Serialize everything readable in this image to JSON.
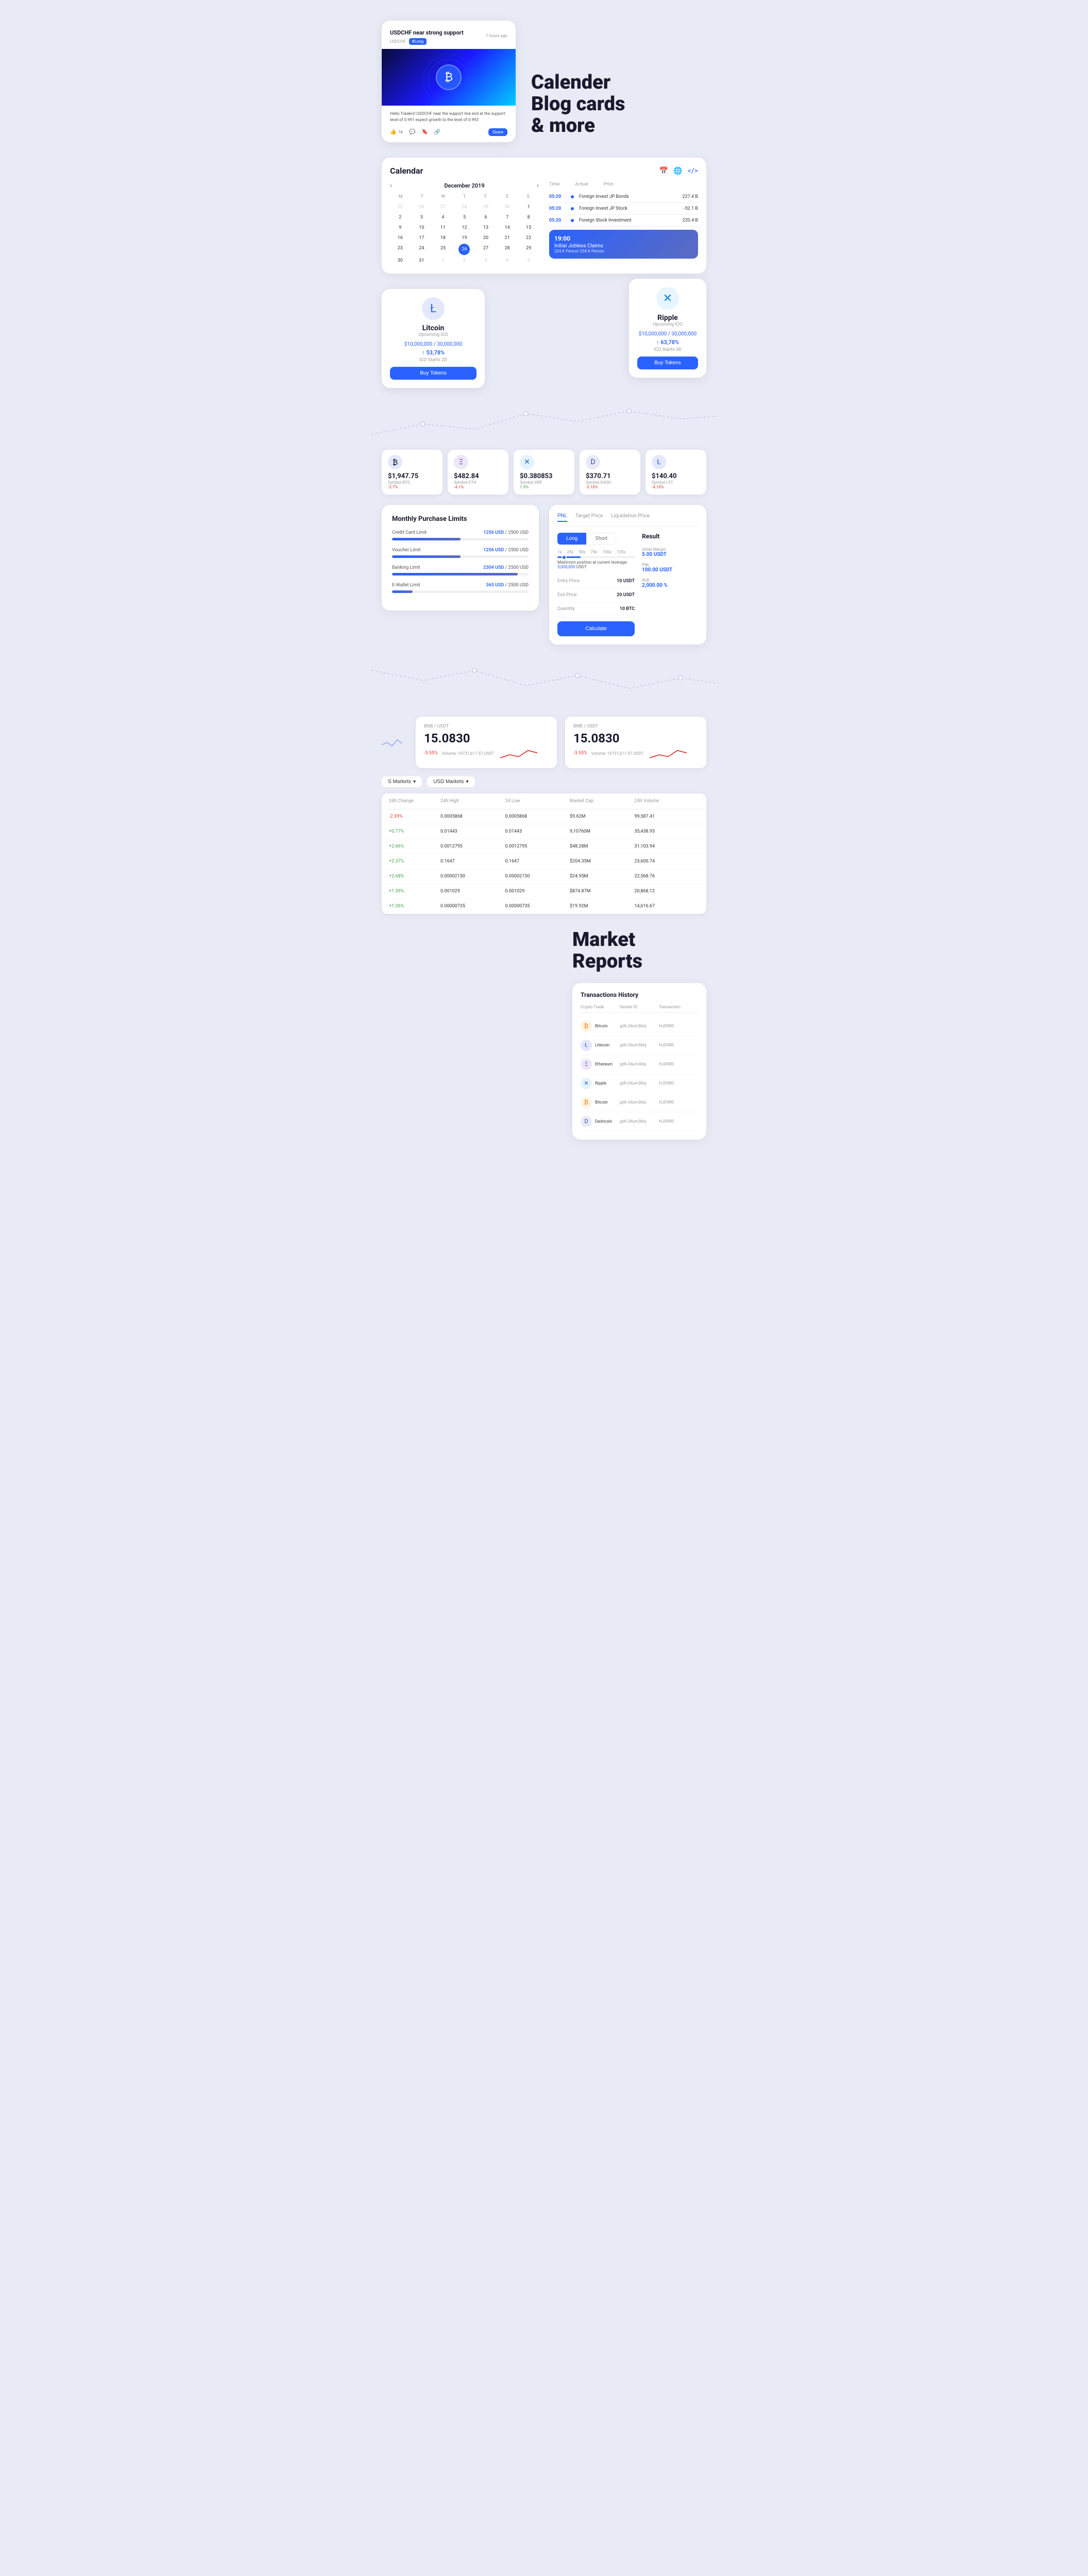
{
  "blogCard": {
    "title": "USDCHF near strong support",
    "ticker": "USDCHF",
    "badge": "#Long",
    "timeAgo": "7 hours ago",
    "description": "Hello Traders! USDCHF near the support line end at the support level of 0.991 expect growth to the level of 0.993",
    "likeCount": "1k",
    "commentCount": "",
    "shareLabel": "Share"
  },
  "sectionHeading": "Calender\nBlog cards\n& more",
  "calendar": {
    "label": "Calendar",
    "month": "December 2019",
    "days": [
      "M",
      "T",
      "W",
      "T",
      "F",
      "S",
      "S"
    ],
    "cells": [
      "25",
      "26",
      "27",
      "28",
      "29",
      "30",
      "1",
      "2",
      "3",
      "4",
      "5",
      "6",
      "7",
      "8",
      "9",
      "10",
      "11",
      "12",
      "13",
      "14",
      "15",
      "16",
      "17",
      "18",
      "19",
      "20",
      "21",
      "22",
      "23",
      "24",
      "25",
      "26",
      "27",
      "28",
      "29",
      "30",
      "31",
      "1",
      "2",
      "3",
      "4",
      "5"
    ],
    "today": "26",
    "events": {
      "headers": [
        "Time",
        "Actual",
        "Prior"
      ],
      "rows": [
        {
          "time": "05:20",
          "name": "Foreign Invest JP Bonds",
          "value": "227.4 B"
        },
        {
          "time": "05:20",
          "name": "Foreign Invest JP Stock",
          "value": "-52.1 B"
        },
        {
          "time": "05:20",
          "name": "Foreign Stock Investment",
          "value": "220.4 B"
        }
      ],
      "featured": {
        "time": "19:00",
        "title": "Initial Jobless Claims",
        "desc": "224 K Person 234 K Person"
      }
    }
  },
  "icoCards": {
    "litecoin": {
      "name": "Litcoin",
      "type": "Upcoming ICO",
      "amount": "$10,000,000 / 30,000,000",
      "change": "53,78%",
      "starts": "ICO Starts 2D",
      "buyLabel": "Buy Tokens"
    },
    "ripple": {
      "name": "Ripple",
      "type": "Upcoming ICO",
      "amount": "$10,000,000 / 30,000,000",
      "change": "63,78%",
      "starts": "ICO Starts 3D",
      "buyLabel": "Buy Tokens"
    }
  },
  "tickers": [
    {
      "symbol": "Symbol BTC",
      "price": "$1,947.75",
      "change": "-3.7%",
      "icon": "₿",
      "negative": true
    },
    {
      "symbol": "Symbol ETH",
      "price": "$482.84",
      "change": "-4.1%",
      "icon": "Ξ",
      "negative": true
    },
    {
      "symbol": "Symbol XRP",
      "price": "$0.380853",
      "change": "1.9%",
      "icon": "✕",
      "negative": false
    },
    {
      "symbol": "Symbol DASH",
      "price": "$370.71",
      "change": "-3.16%",
      "icon": "D",
      "negative": true
    },
    {
      "symbol": "Symbol LTC",
      "price": "$140.40",
      "change": "-4.16%",
      "icon": "Ł",
      "negative": true
    }
  ],
  "purchaseLimits": {
    "title": "Monthly Purchase Limits",
    "limits": [
      {
        "name": "Credit Card Limit",
        "used": "1256 USD",
        "total": "2500 USD",
        "percent": 50
      },
      {
        "name": "Voucher Limit",
        "used": "1256 USD",
        "total": "2500 USD",
        "percent": 50
      },
      {
        "name": "Banking Limit",
        "used": "2304 USD",
        "total": "2500 USD",
        "percent": 92
      },
      {
        "name": "E-Wallet Limit",
        "used": "365 USD",
        "total": "2500 USD",
        "percent": 15
      }
    ]
  },
  "pnlCalc": {
    "tabs": [
      "PNL",
      "Target Price",
      "Liquidation Price"
    ],
    "activeTab": "PNL",
    "toggleLong": "Long",
    "toggleShort": "Short",
    "activeToggle": "Long",
    "resultLabel": "Result",
    "leverageMarks": [
      "1x",
      "25x",
      "50x",
      "75x",
      "100x",
      "125x"
    ],
    "maxLeverage": "Maximum position at current leverage: 5,000,000 USDT",
    "fields": [
      {
        "label": "Entry Price",
        "value": "10 USDT"
      },
      {
        "label": "Exit Price",
        "value": "20 USDT"
      },
      {
        "label": "Quantity",
        "value": "10 BTC"
      }
    ],
    "results": [
      {
        "name": "Initial Margin",
        "value": "5.00 USDT"
      },
      {
        "name": "PNL",
        "value": "100.00 USDT"
      },
      {
        "name": "ROE",
        "value": "2,000.00 %"
      }
    ],
    "calculateLabel": "Calculate"
  },
  "marketSection": {
    "tickers": [
      {
        "pair": "BNB / USDT",
        "price": "15.0830",
        "change": "-3.55%",
        "volume": "Volume: 16731,611.57 USDT"
      },
      {
        "pair": "BNB / USDT",
        "price": "15.0830",
        "change": "-3.55%",
        "volume": "Volume: 16731,611.57 USDT"
      }
    ],
    "tabs": [
      "S Markets",
      "USD Markets"
    ],
    "tableHeaders": [
      "24h Change",
      "24h High",
      "24 Low",
      "Market Cap",
      "24h Volume"
    ],
    "tableRows": [
      {
        "-3.39%": "",
        "high": "0.0005868",
        "low": "0.0005868",
        "cap": "$9.62M",
        "vol": "99,587.41",
        "change": "-2.39%"
      },
      {
        "change": "+0.77%",
        "high": "0.01443",
        "low": "0.01443",
        "cap": "9,10760M",
        "vol": "35,438.93"
      },
      {
        "change": "+2.66%",
        "high": "0.0012795",
        "low": "0.0012795",
        "cap": "$48.28M",
        "vol": "31,103.94"
      },
      {
        "change": "+2.37%",
        "high": "0.1647",
        "low": "0.1647",
        "cap": "$204.35M",
        "vol": "23,600.74"
      },
      {
        "change": "+2.68%",
        "high": "0.00002150",
        "low": "0.00002150",
        "cap": "$24.95M",
        "vol": "22,568.76"
      },
      {
        "change": "+1.39%",
        "high": "0.001029",
        "low": "0.001029",
        "cap": "$874.87M",
        "vol": "20,868.12"
      },
      {
        "change": "+1.26%",
        "high": "0.00000735",
        "low": "0.00000735",
        "cap": "$19.92M",
        "vol": "14,616.67"
      }
    ],
    "tableRowsData": [
      [
        "-2.39%",
        "0.0005868",
        "0.0005868",
        "$9.62M",
        "99,587.41",
        "negative"
      ],
      [
        "+0.77%",
        "0.01443",
        "0.01443",
        "9,10760M",
        "35,438.93",
        "positive"
      ],
      [
        "+2.66%",
        "0.0012795",
        "0.0012795",
        "$48.28M",
        "31,103.94",
        "positive"
      ],
      [
        "+2.37%",
        "0.1647",
        "0.1647",
        "$204.35M",
        "23,600.74",
        "positive"
      ],
      [
        "+2.68%",
        "0.00002150",
        "0.00002150",
        "$24.95M",
        "22,568.76",
        "positive"
      ],
      [
        "+1.39%",
        "0.001029",
        "0.001029",
        "$874.87M",
        "20,868.12",
        "positive"
      ],
      [
        "+1.26%",
        "0.00000735",
        "0.00000735",
        "$19.92M",
        "14,616.67",
        "positive"
      ]
    ]
  },
  "marketReports": {
    "title": "Market\nReports",
    "transactions": {
      "title": "Transactions History",
      "headers": [
        "Crypto Trade",
        "Sender ID",
        "Transaction"
      ],
      "rows": [
        {
          "name": "Bitcoin",
          "senderId": "gdh-34um3blq",
          "txHash": "HJD9R0",
          "icon": "btc"
        },
        {
          "name": "Litecoin",
          "senderId": "gdh-34um3blq",
          "txHash": "HJD9R0",
          "icon": "ltc"
        },
        {
          "name": "Ethereum",
          "senderId": "gdh-34um3blq",
          "txHash": "HJD9R0",
          "icon": "eth"
        },
        {
          "name": "Ripple",
          "senderId": "gdh-34um3blq",
          "txHash": "HJD9R0",
          "icon": "xrp"
        },
        {
          "name": "Bitcoin",
          "senderId": "gdh-34um3blq",
          "txHash": "HJD9R0",
          "icon": "btc"
        },
        {
          "name": "Dashcoin",
          "senderId": "gdh-34um3blq",
          "txHash": "HJD9R0",
          "icon": "dash"
        }
      ]
    }
  }
}
